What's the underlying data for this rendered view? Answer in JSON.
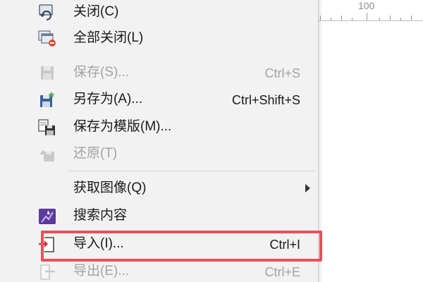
{
  "ruler": {
    "label": "100"
  },
  "menu": {
    "items": [
      {
        "id": "close",
        "label": "关闭(C)",
        "shortcut": "",
        "disabled": false,
        "icon": "close-file-icon"
      },
      {
        "id": "close-all",
        "label": "全部关闭(L)",
        "shortcut": "",
        "disabled": false,
        "icon": "close-all-icon"
      },
      {
        "id": "save",
        "label": "保存(S)...",
        "shortcut": "Ctrl+S",
        "disabled": true,
        "icon": "save-icon"
      },
      {
        "id": "save-as",
        "label": "另存为(A)...",
        "shortcut": "Ctrl+Shift+S",
        "disabled": false,
        "icon": "save-as-icon"
      },
      {
        "id": "save-template",
        "label": "保存为模版(M)...",
        "shortcut": "",
        "disabled": false,
        "icon": "save-template-icon"
      },
      {
        "id": "revert",
        "label": "还原(T)",
        "shortcut": "",
        "disabled": true,
        "icon": "revert-icon"
      },
      {
        "id": "acquire-image",
        "label": "获取图像(Q)",
        "shortcut": "",
        "disabled": false,
        "icon": "",
        "submenu": true
      },
      {
        "id": "search-content",
        "label": "搜索内容",
        "shortcut": "",
        "disabled": false,
        "icon": "search-content-icon"
      },
      {
        "id": "import",
        "label": "导入(I)...",
        "shortcut": "Ctrl+I",
        "disabled": false,
        "icon": "import-icon",
        "highlighted": true
      },
      {
        "id": "export",
        "label": "导出(E)...",
        "shortcut": "Ctrl+E",
        "disabled": true,
        "icon": "export-icon"
      }
    ]
  },
  "colors": {
    "highlight": "#e8525c",
    "menu_bg": "#f2f2f2",
    "disabled_text": "#a3a3a3"
  }
}
